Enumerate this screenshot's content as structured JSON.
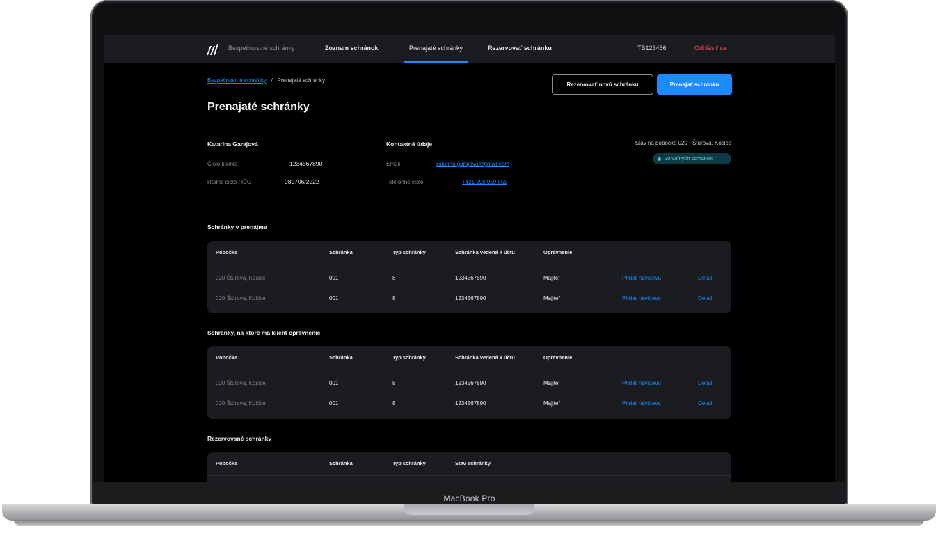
{
  "device": {
    "label": "MacBook Pro"
  },
  "topbar": {
    "brand": "Bezpečnostné schránky",
    "nav": [
      {
        "label": "Zoznam schránok"
      },
      {
        "label": "Prenajaté schránky",
        "active": true
      },
      {
        "label": "Rezervovať schránku"
      }
    ],
    "user_id": "TB123456",
    "logout": "Odhlásiť sa"
  },
  "breadcrumb": {
    "root": "Bezpečnostné schránky",
    "separator": "/",
    "current": "Prenajaté schránky"
  },
  "actions": {
    "reserve_new": "Rezervovať novú schránku",
    "rent": "Prenajať schránku"
  },
  "page_title": "Prenajaté schránky",
  "client": {
    "name": "Katarína Garajová",
    "client_no_label": "Číslo klienta",
    "client_no": "1234567890",
    "birth_no_label": "Rodné číslo / IČO",
    "birth_no": "980706/2222"
  },
  "contact": {
    "title": "Kontaktné údaje",
    "email_label": "Email",
    "email": "katarina.garajova@gmail.com",
    "phone_label": "Telefónne číslo",
    "phone": "+421 090 959 555"
  },
  "branch": {
    "state": "Stav na pobočke 020 - Štúrova, Košice",
    "free": "20 voľných schránok"
  },
  "sections": {
    "rented": "Schránky v prenájme",
    "authorized": "Schránky, na ktoré má klient oprávnenie",
    "reserved": "Rezervované schránky"
  },
  "table_headers": {
    "branch": "Pobočka",
    "box": "Schránka",
    "type": "Typ schránky",
    "account": "Schránka vedená k účtu",
    "permission": "Oprávnenie",
    "box_state": "Stav schránky"
  },
  "rented_rows": [
    {
      "branch": "020 Štúrova, Košice",
      "box": "001",
      "type": "8",
      "account": "1234567890",
      "permission": "Majiteľ",
      "add_visit": "Pridať návštevu",
      "detail": "Detail"
    },
    {
      "branch": "020 Štúrova, Košice",
      "box": "001",
      "type": "8",
      "account": "1234567890",
      "permission": "Majiteľ",
      "add_visit": "Pridať návštevu",
      "detail": "Detail"
    }
  ],
  "authorized_rows": [
    {
      "branch": "020 Štúrova, Košice",
      "box": "001",
      "type": "8",
      "account": "1234567890",
      "permission": "Majiteľ",
      "add_visit": "Pridať návštevu",
      "detail": "Detail"
    },
    {
      "branch": "020 Štúrova, Košice",
      "box": "001",
      "type": "8",
      "account": "1234567890",
      "permission": "Majiteľ",
      "add_visit": "Pridať návštevu",
      "detail": "Detail"
    }
  ],
  "colors": {
    "accent": "#1a8cff",
    "logout": "#ff4d5b",
    "background": "#000000",
    "card": "#1b1c20"
  }
}
